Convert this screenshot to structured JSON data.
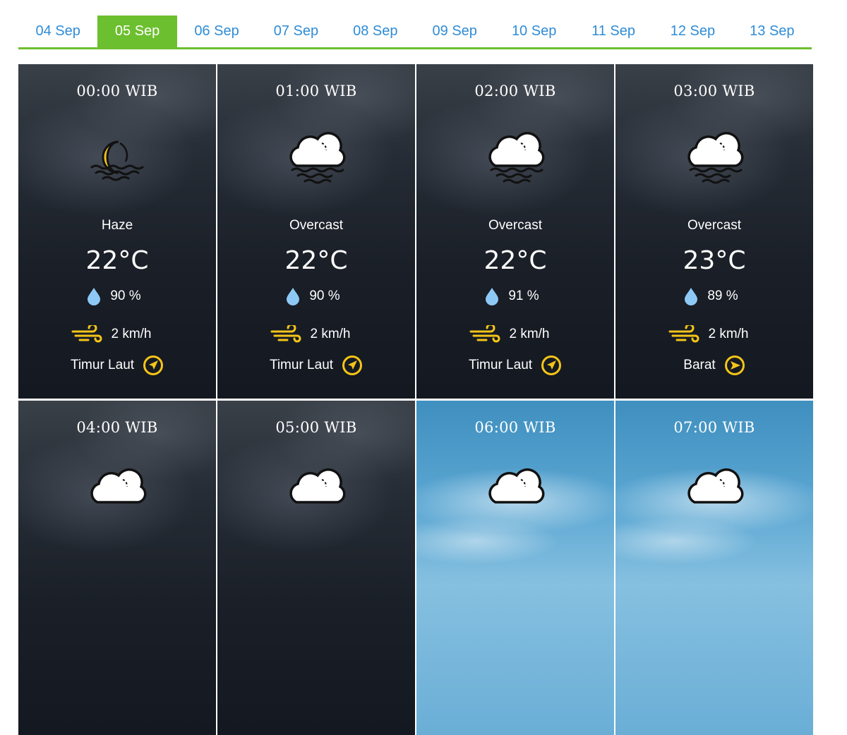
{
  "tabs": [
    {
      "label": "04 Sep",
      "active": false
    },
    {
      "label": "05 Sep",
      "active": true
    },
    {
      "label": "06 Sep",
      "active": false
    },
    {
      "label": "07 Sep",
      "active": false
    },
    {
      "label": "08 Sep",
      "active": false
    },
    {
      "label": "09 Sep",
      "active": false
    },
    {
      "label": "10 Sep",
      "active": false
    },
    {
      "label": "11 Sep",
      "active": false
    },
    {
      "label": "12 Sep",
      "active": false
    },
    {
      "label": "13 Sep",
      "active": false
    }
  ],
  "colors": {
    "accent": "#6cbf2e",
    "tab_text": "#2f8cd6",
    "icon_yellow": "#f5c518",
    "drop_blue": "#8ec9f5"
  },
  "forecast": [
    {
      "time": "00:00 WIB",
      "icon": "haze-night-icon",
      "condition": "Haze",
      "temp": "22°C",
      "humidity": "90 %",
      "wind_speed": "2 km/h",
      "wind_direction": "Timur Laut",
      "wind_icon": "compass-northeast-icon",
      "sky": "night"
    },
    {
      "time": "01:00 WIB",
      "icon": "overcast-icon",
      "condition": "Overcast",
      "temp": "22°C",
      "humidity": "90 %",
      "wind_speed": "2 km/h",
      "wind_direction": "Timur Laut",
      "wind_icon": "compass-northeast-icon",
      "sky": "night"
    },
    {
      "time": "02:00 WIB",
      "icon": "overcast-icon",
      "condition": "Overcast",
      "temp": "22°C",
      "humidity": "91 %",
      "wind_speed": "2 km/h",
      "wind_direction": "Timur Laut",
      "wind_icon": "compass-northeast-icon",
      "sky": "night"
    },
    {
      "time": "03:00 WIB",
      "icon": "overcast-icon",
      "condition": "Overcast",
      "temp": "23°C",
      "humidity": "89 %",
      "wind_speed": "2 km/h",
      "wind_direction": "Barat",
      "wind_icon": "compass-east-icon",
      "sky": "night"
    },
    {
      "time": "04:00 WIB",
      "icon": "overcast-icon",
      "sky": "night"
    },
    {
      "time": "05:00 WIB",
      "icon": "overcast-icon",
      "sky": "night"
    },
    {
      "time": "06:00 WIB",
      "icon": "overcast-icon",
      "sky": "day"
    },
    {
      "time": "07:00 WIB",
      "icon": "overcast-icon",
      "sky": "day"
    }
  ]
}
